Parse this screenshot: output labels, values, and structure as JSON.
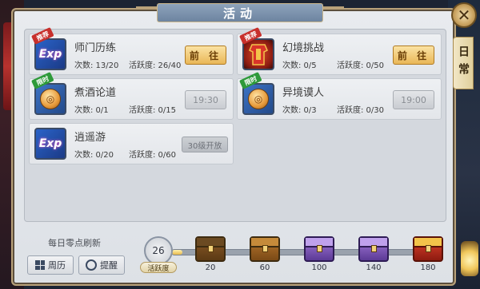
{
  "window": {
    "title": "活动",
    "close_glyph": "✕",
    "side_tab_label": "日常"
  },
  "activities": [
    {
      "name": "师门历练",
      "badge": "推荐",
      "badge_color": "#c8302c",
      "icon": "exp-icon",
      "icon_text": "Exp",
      "count": "次数: 13/20",
      "liveness": "活跃度: 26/40",
      "action": "前 往",
      "action_type": "go"
    },
    {
      "name": "幻境挑战",
      "badge": "推荐",
      "badge_color": "#c8302c",
      "icon": "armor-icon",
      "icon_text": "",
      "count": "次数: 0/5",
      "liveness": "活跃度: 0/50",
      "action": "前 往",
      "action_type": "go"
    },
    {
      "name": "煮酒论道",
      "badge": "限时",
      "badge_color": "#2e9a3a",
      "icon": "coin-icon",
      "icon_text": "",
      "count": "次数: 0/1",
      "liveness": "活跃度: 0/15",
      "action": "19:30",
      "action_type": "time"
    },
    {
      "name": "异境谟人",
      "badge": "限时",
      "badge_color": "#2e9a3a",
      "icon": "coin-icon",
      "icon_text": "",
      "count": "次数: 0/3",
      "liveness": "活跃度: 0/30",
      "action": "19:00",
      "action_type": "time"
    },
    {
      "name": "逍遥游",
      "badge": "",
      "badge_color": "",
      "icon": "exp-icon",
      "icon_text": "Exp",
      "count": "次数: 0/20",
      "liveness": "活跃度: 0/60",
      "action": "30级开放",
      "action_type": "level"
    }
  ],
  "footer": {
    "refresh_text": "每日零点刷新",
    "calendar_button": "周历",
    "reminder_button": "提醒",
    "activity_value": "26",
    "activity_label": "活跃度",
    "progress_fraction": 0.04
  },
  "chests": [
    {
      "threshold": "20",
      "style": "wood"
    },
    {
      "threshold": "60",
      "style": "brown"
    },
    {
      "threshold": "100",
      "style": "purple"
    },
    {
      "threshold": "140",
      "style": "purple"
    },
    {
      "threshold": "180",
      "style": "red"
    }
  ]
}
